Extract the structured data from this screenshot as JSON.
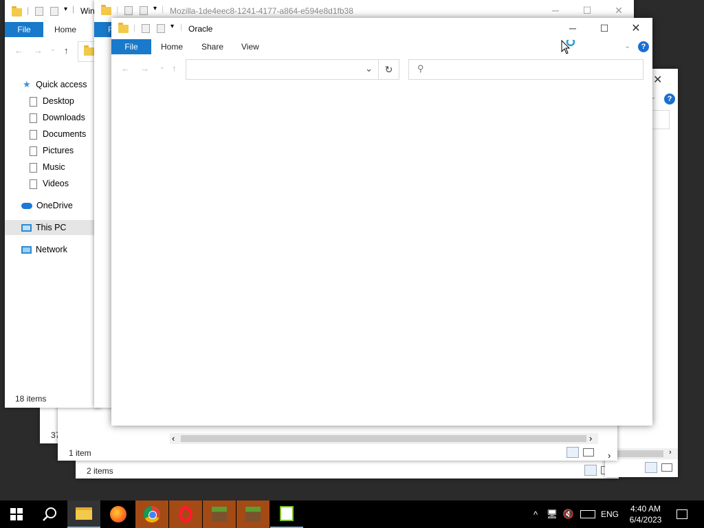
{
  "back_window": {
    "title_partial": "Win",
    "tabs": {
      "file": "File",
      "home": "Home"
    },
    "sidebar": {
      "quick_access": "Quick access",
      "items": [
        "Desktop",
        "Downloads",
        "Documents",
        "Pictures",
        "Music",
        "Videos"
      ],
      "onedrive": "OneDrive",
      "this_pc": "This PC",
      "network": "Network"
    },
    "status": "18 items"
  },
  "window_3": {
    "status_partial": "37"
  },
  "window_4": {
    "status": "2 items"
  },
  "window_5": {
    "status": "1 item"
  },
  "mozilla_window": {
    "title": "Mozilla-1de4eec8-1241-4177-a864-e594e8d1fb38",
    "file_tab_partial": "F"
  },
  "oracle_window": {
    "title": "Oracle",
    "tabs": {
      "file": "File",
      "home": "Home",
      "share": "Share",
      "view": "View"
    },
    "address_value": "",
    "search_placeholder": ""
  },
  "taskbar": {
    "apps": [
      "start",
      "search",
      "file-explorer",
      "firefox",
      "chrome",
      "opera",
      "minecraft",
      "minecraft",
      "notepad-plus-plus"
    ],
    "language": "ENG",
    "time": "4:40 AM",
    "date": "6/4/2023"
  },
  "colors": {
    "accent": "#1979ca",
    "taskbar": "#000000",
    "help": "#1c6fd1"
  }
}
